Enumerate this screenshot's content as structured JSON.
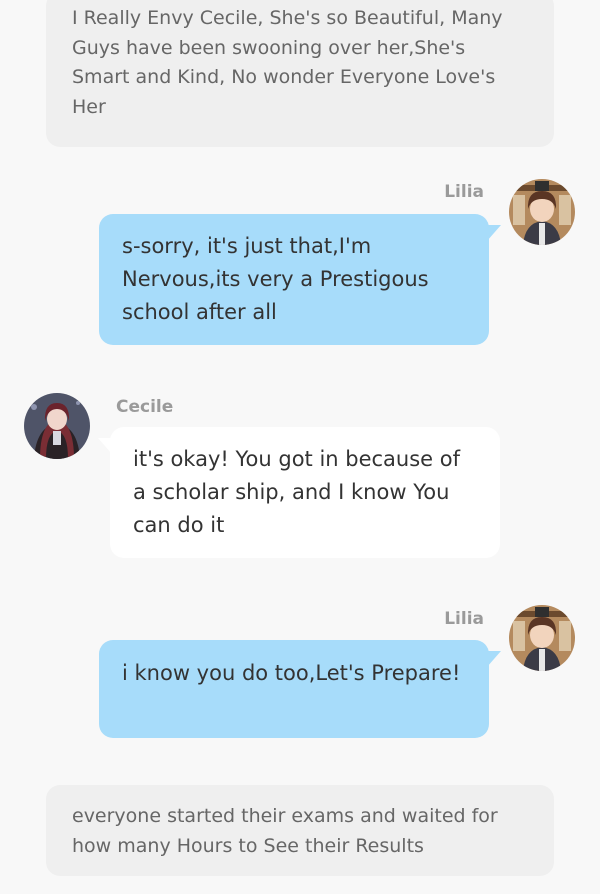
{
  "narration": [
    {
      "text": "I Really Envy Cecile, She's so Beautiful, Many Guys have been swooning over her,She's Smart and Kind, No wonder Everyone Love's Her"
    },
    {
      "text": "everyone started their exams and waited for how many Hours to See their Results"
    }
  ],
  "messages": [
    {
      "speaker": "Lilia",
      "text": "s-sorry, it's just that,I'm Nervous,its very a Prestigous school after all"
    },
    {
      "speaker": "Cecile",
      "text": "it's okay! You got in because of a scholar ship, and I know You can do it"
    },
    {
      "speaker": "Lilia",
      "text": "i know you do too,Let's Prepare!"
    }
  ],
  "colors": {
    "bubble_blue": "#a7dcfa",
    "bubble_white": "#ffffff",
    "narration_bg": "#efefef",
    "background": "#f8f8f8",
    "name_gray": "#9a9a9a"
  },
  "icons": {
    "lilia_avatar": "lilia-avatar",
    "cecile_avatar": "cecile-avatar"
  }
}
